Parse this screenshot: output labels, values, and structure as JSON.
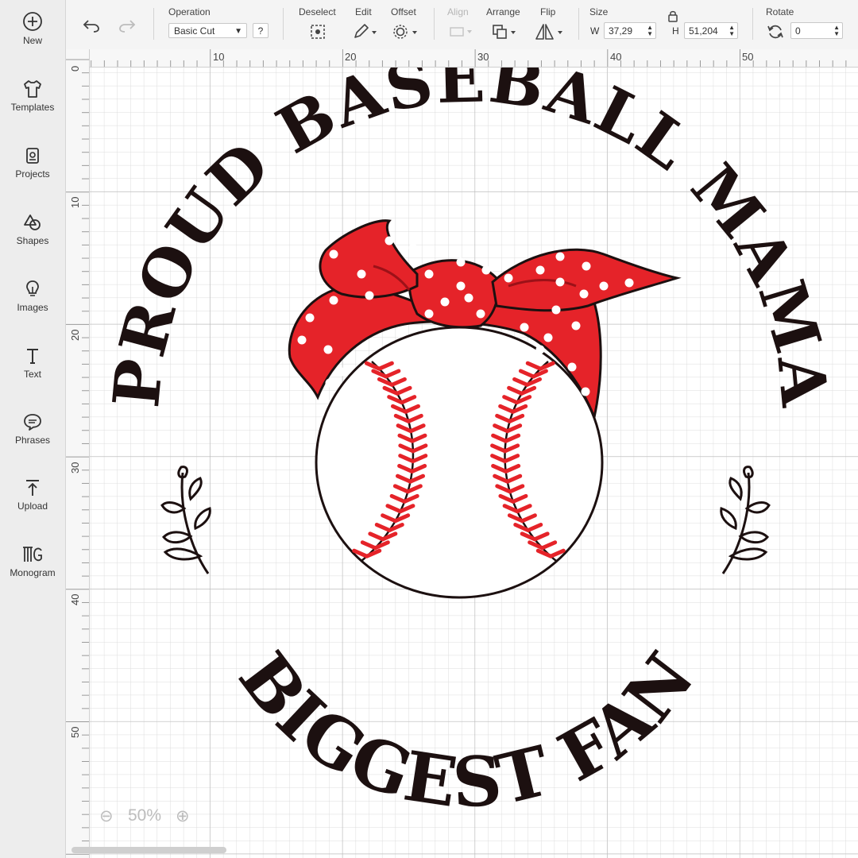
{
  "sidebar": {
    "items": [
      {
        "label": "New",
        "icon": "plus-circle-icon"
      },
      {
        "label": "Templates",
        "icon": "tshirt-icon"
      },
      {
        "label": "Projects",
        "icon": "projects-icon"
      },
      {
        "label": "Shapes",
        "icon": "shapes-icon"
      },
      {
        "label": "Images",
        "icon": "lightbulb-icon"
      },
      {
        "label": "Text",
        "icon": "text-icon"
      },
      {
        "label": "Phrases",
        "icon": "speech-bubble-icon"
      },
      {
        "label": "Upload",
        "icon": "upload-icon"
      },
      {
        "label": "Monogram",
        "icon": "monogram-icon"
      }
    ]
  },
  "toolbar": {
    "operation_label": "Operation",
    "operation_value": "Basic Cut",
    "help_label": "?",
    "deselect_label": "Deselect",
    "edit_label": "Edit",
    "offset_label": "Offset",
    "align_label": "Align",
    "arrange_label": "Arrange",
    "flip_label": "Flip",
    "size_label": "Size",
    "width_prefix": "W",
    "width_value": "37,29",
    "height_prefix": "H",
    "height_value": "51,204",
    "rotate_label": "Rotate",
    "rotate_value": "0"
  },
  "ruler": {
    "top_labels": [
      "10",
      "20",
      "30",
      "40",
      "50"
    ],
    "left_labels": [
      "0",
      "10",
      "20",
      "30",
      "40",
      "50"
    ]
  },
  "design": {
    "top_text": "PROUD BASEBALL MAMA",
    "bottom_text": "BIGGEST FAN",
    "bandana_color": "#e52329",
    "stitch_color": "#e52329",
    "ink_color": "#1c1010"
  },
  "zoom": {
    "minus": "⊖",
    "level": "50%",
    "plus": "⊕"
  }
}
